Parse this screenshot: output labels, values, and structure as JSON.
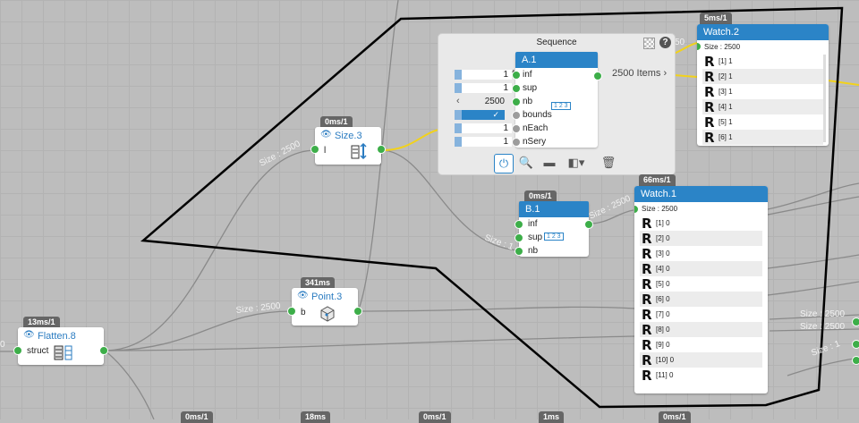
{
  "canvas": {
    "wire_color": "#8a8a8a",
    "active_wire_color": "#f2d21b",
    "selection_color": "#000000"
  },
  "wire_labels": {
    "size_top": "Size : 2500",
    "size_point": "Size : 2500",
    "size_b1": "Size : 1",
    "size_watch1": "Size : 2500",
    "watch2_in": "50",
    "flatten_left": "0",
    "right_a": "Size : 2500",
    "right_b": "Size : 2500",
    "right_c": "Size : 1"
  },
  "nodes": {
    "size3": {
      "time": "0ms/1",
      "title": "Size.3",
      "port_label": "l"
    },
    "point3": {
      "time": "341ms",
      "title": "Point.3",
      "port_label": "b"
    },
    "flatten8": {
      "time": "13ms/1",
      "title": "Flatten.8",
      "port_label": "struct"
    },
    "b1": {
      "time": "0ms/1",
      "title": "B.1",
      "ports": [
        "inf",
        "sup",
        "nb"
      ],
      "sup_badge": "1 2 3"
    },
    "bottom_times": [
      "0ms/1",
      "18ms",
      "0ms/1",
      "1ms",
      "0ms/1"
    ]
  },
  "sequence": {
    "title": "Sequence",
    "inner_title": "A.1",
    "output_label": "2500 Items",
    "nb_value": "2500",
    "nb_badge": "1 2 3",
    "params": [
      {
        "label": "inf",
        "value": "1"
      },
      {
        "label": "sup",
        "value": "1"
      },
      {
        "label": "nb",
        "value": "2500"
      },
      {
        "label": "bounds",
        "value": "✓"
      },
      {
        "label": "nEach",
        "value": "1"
      },
      {
        "label": "nSery",
        "value": "1"
      }
    ]
  },
  "watch2": {
    "time": "5ms/1",
    "title": "Watch.2",
    "size": "Size : 2500",
    "items": [
      "[1] 1",
      "[2] 1",
      "[3] 1",
      "[4] 1",
      "[5] 1",
      "[6] 1"
    ]
  },
  "watch1": {
    "time": "66ms/1",
    "title": "Watch.1",
    "size": "Size : 2500",
    "items": [
      "[1] 0",
      "[2] 0",
      "[3] 0",
      "[4] 0",
      "[5] 0",
      "[6] 0",
      "[7] 0",
      "[8] 0",
      "[9] 0",
      "[10] 0",
      "[11] 0"
    ]
  }
}
